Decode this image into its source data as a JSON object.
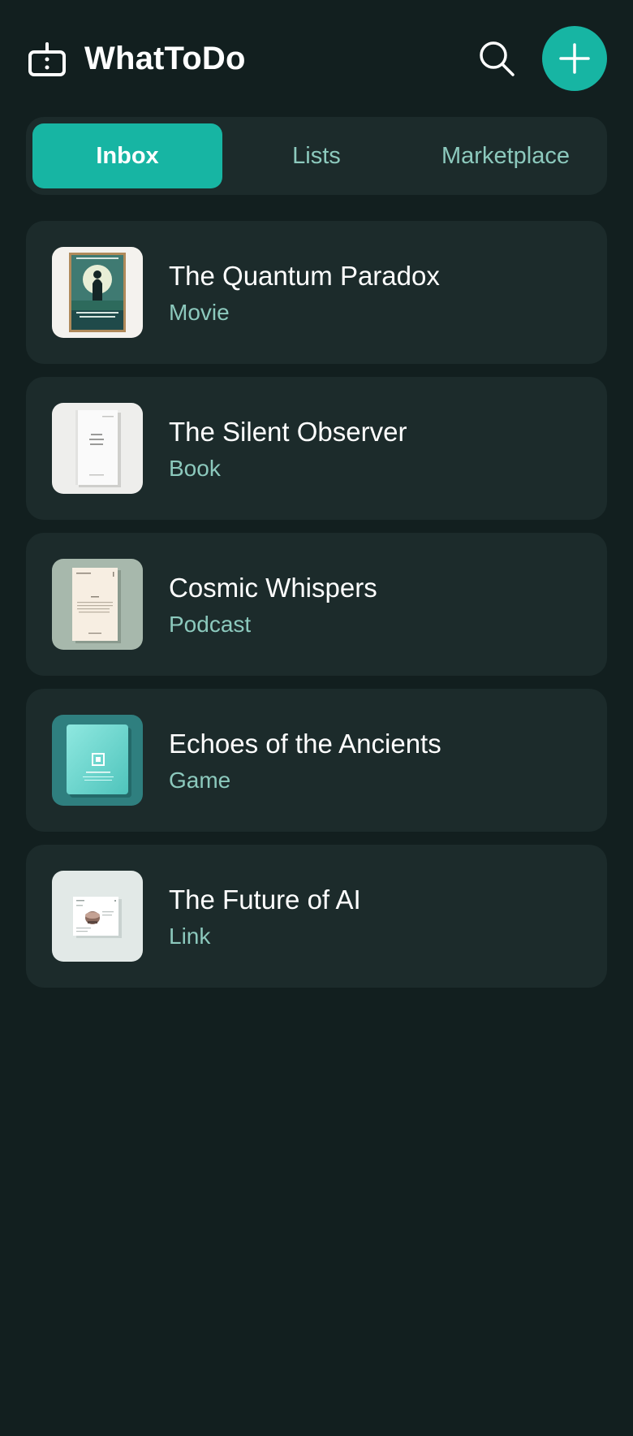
{
  "app": {
    "title": "WhatToDo",
    "logo_icon": "tv-icon",
    "accent_color": "#17b5a3",
    "background_color": "#121f1f",
    "card_color": "#1c2b2b",
    "subtitle_color": "#8cc9bd"
  },
  "header": {
    "search_icon": "search-icon",
    "add_icon": "plus-icon"
  },
  "tabs": [
    {
      "label": "Inbox",
      "active": true
    },
    {
      "label": "Lists",
      "active": false
    },
    {
      "label": "Marketplace",
      "active": false
    }
  ],
  "items": [
    {
      "title": "The Quantum Paradox",
      "type": "Movie",
      "thumbnail": "movie-poster-thumbnail"
    },
    {
      "title": "The Silent Observer",
      "type": "Book",
      "thumbnail": "book-cover-thumbnail"
    },
    {
      "title": "Cosmic Whispers",
      "type": "Podcast",
      "thumbnail": "podcast-cover-thumbnail"
    },
    {
      "title": "Echoes of the Ancients",
      "type": "Game",
      "thumbnail": "game-cover-thumbnail"
    },
    {
      "title": "The Future of AI",
      "type": "Link",
      "thumbnail": "link-preview-thumbnail"
    }
  ]
}
